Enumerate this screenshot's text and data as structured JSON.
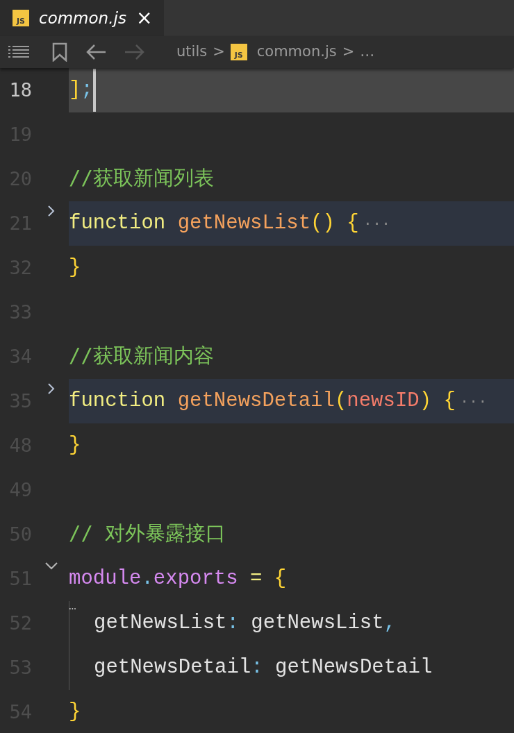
{
  "tab": {
    "title": "common.js",
    "file_type": "JS",
    "close": "×",
    "selected": true
  },
  "breadcrumb": {
    "items": [
      {
        "kind": "folder",
        "label": "utils"
      },
      {
        "kind": "file",
        "label": "common.js",
        "file_type": "JS"
      },
      {
        "kind": "more",
        "label": "…"
      }
    ],
    "separator": ">"
  },
  "lines": [
    {
      "number": "18",
      "current": true,
      "highlighted": false,
      "guide": false,
      "tokens": [
        {
          "kind": "bracket",
          "text": "]"
        },
        {
          "kind": "punct",
          "text": ";"
        }
      ]
    },
    {
      "number": "19",
      "current": false,
      "highlighted": false,
      "guide": false
    },
    {
      "number": "20",
      "current": false,
      "highlighted": false,
      "guide": false,
      "tokens": [
        {
          "kind": "comment",
          "text": "//获取新闻列表"
        }
      ]
    },
    {
      "number": "21",
      "current": false,
      "collapsed": true,
      "highlighted": true,
      "guide": false,
      "tokens": [
        {
          "kind": "keyword",
          "text": "function"
        },
        {
          "kind": "func",
          "text": " getNewsList"
        },
        {
          "kind": "bracket",
          "text": "()"
        },
        {
          "kind": "bracket",
          "text": " {"
        },
        {
          "kind": "ellipsis",
          "text": "···"
        }
      ]
    },
    {
      "number": "32",
      "current": false,
      "highlighted": false,
      "guide": false,
      "tokens": [
        {
          "kind": "bracket",
          "text": "}"
        }
      ]
    },
    {
      "number": "33",
      "current": false,
      "highlighted": false,
      "guide": false
    },
    {
      "number": "34",
      "current": false,
      "highlighted": false,
      "guide": false,
      "tokens": [
        {
          "kind": "comment",
          "text": "//获取新闻内容"
        }
      ]
    },
    {
      "number": "35",
      "current": false,
      "collapsed": true,
      "highlighted": true,
      "guide": false,
      "tokens": [
        {
          "kind": "keyword",
          "text": "function"
        },
        {
          "kind": "func",
          "text": " getNewsDetail"
        },
        {
          "kind": "bracket",
          "text": "("
        },
        {
          "kind": "param",
          "text": "newsID"
        },
        {
          "kind": "bracket",
          "text": ")"
        },
        {
          "kind": "bracket",
          "text": " {"
        },
        {
          "kind": "ellipsis",
          "text": "···"
        }
      ]
    },
    {
      "number": "48",
      "current": false,
      "highlighted": false,
      "guide": false,
      "tokens": [
        {
          "kind": "bracket",
          "text": "}"
        }
      ]
    },
    {
      "number": "49",
      "current": false,
      "highlighted": false,
      "guide": false
    },
    {
      "number": "50",
      "current": false,
      "highlighted": false,
      "guide": false,
      "tokens": [
        {
          "kind": "comment",
          "text": "// 对外暴露接口"
        }
      ]
    },
    {
      "number": "51",
      "current": false,
      "collapsed": false,
      "highlighted": false,
      "guide": false,
      "hint": "…",
      "tokens": [
        {
          "kind": "module",
          "text": "module"
        },
        {
          "kind": "punct",
          "text": "."
        },
        {
          "kind": "module",
          "text": "exports"
        },
        {
          "kind": "operator",
          "text": " ="
        },
        {
          "kind": "bracket",
          "text": " {"
        }
      ]
    },
    {
      "number": "52",
      "current": false,
      "highlighted": false,
      "guide": true,
      "tokens": [
        {
          "kind": "plain",
          "text": "getNewsList"
        },
        {
          "kind": "punct",
          "text": ":"
        },
        {
          "kind": "plain",
          "text": " getNewsList"
        },
        {
          "kind": "punct",
          "text": ","
        }
      ]
    },
    {
      "number": "53",
      "current": false,
      "highlighted": false,
      "guide": true,
      "tokens": [
        {
          "kind": "plain",
          "text": "getNewsDetail"
        },
        {
          "kind": "punct",
          "text": ":"
        },
        {
          "kind": "plain",
          "text": " getNewsDetail"
        }
      ]
    },
    {
      "number": "54",
      "current": false,
      "highlighted": false,
      "guide": false,
      "tokens": [
        {
          "kind": "bracket",
          "text": "}"
        }
      ]
    }
  ]
}
